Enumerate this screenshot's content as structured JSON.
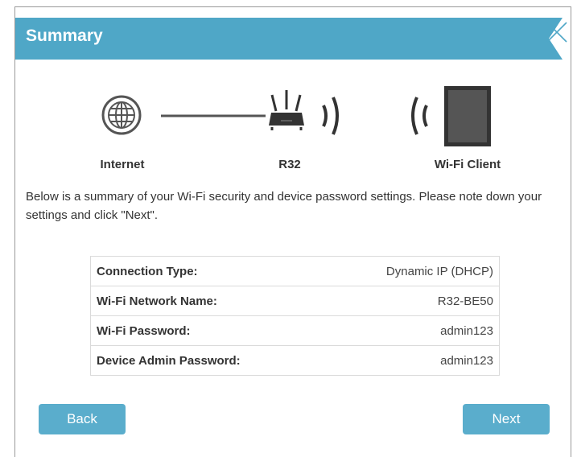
{
  "header": {
    "title": "Summary",
    "close_icon": "close-icon"
  },
  "diagram": {
    "internet_label": "Internet",
    "router_label": "R32",
    "client_label": "Wi-Fi Client",
    "icons": [
      "globe-icon",
      "router-icon",
      "wifi-wave-icon",
      "tablet-icon"
    ]
  },
  "description": "Below is a summary of your Wi-Fi security and device password settings. Please note down your settings and click \"Next\".",
  "summary_rows": [
    {
      "label": "Connection Type:",
      "value": "Dynamic IP (DHCP)"
    },
    {
      "label": "Wi-Fi Network Name:",
      "value": "R32-BE50"
    },
    {
      "label": "Wi-Fi Password:",
      "value": "admin123"
    },
    {
      "label": "Device Admin Password:",
      "value": "admin123"
    }
  ],
  "buttons": {
    "back": "Back",
    "next": "Next"
  },
  "colors": {
    "accent": "#4fa7c7",
    "button": "#5aadcc"
  }
}
